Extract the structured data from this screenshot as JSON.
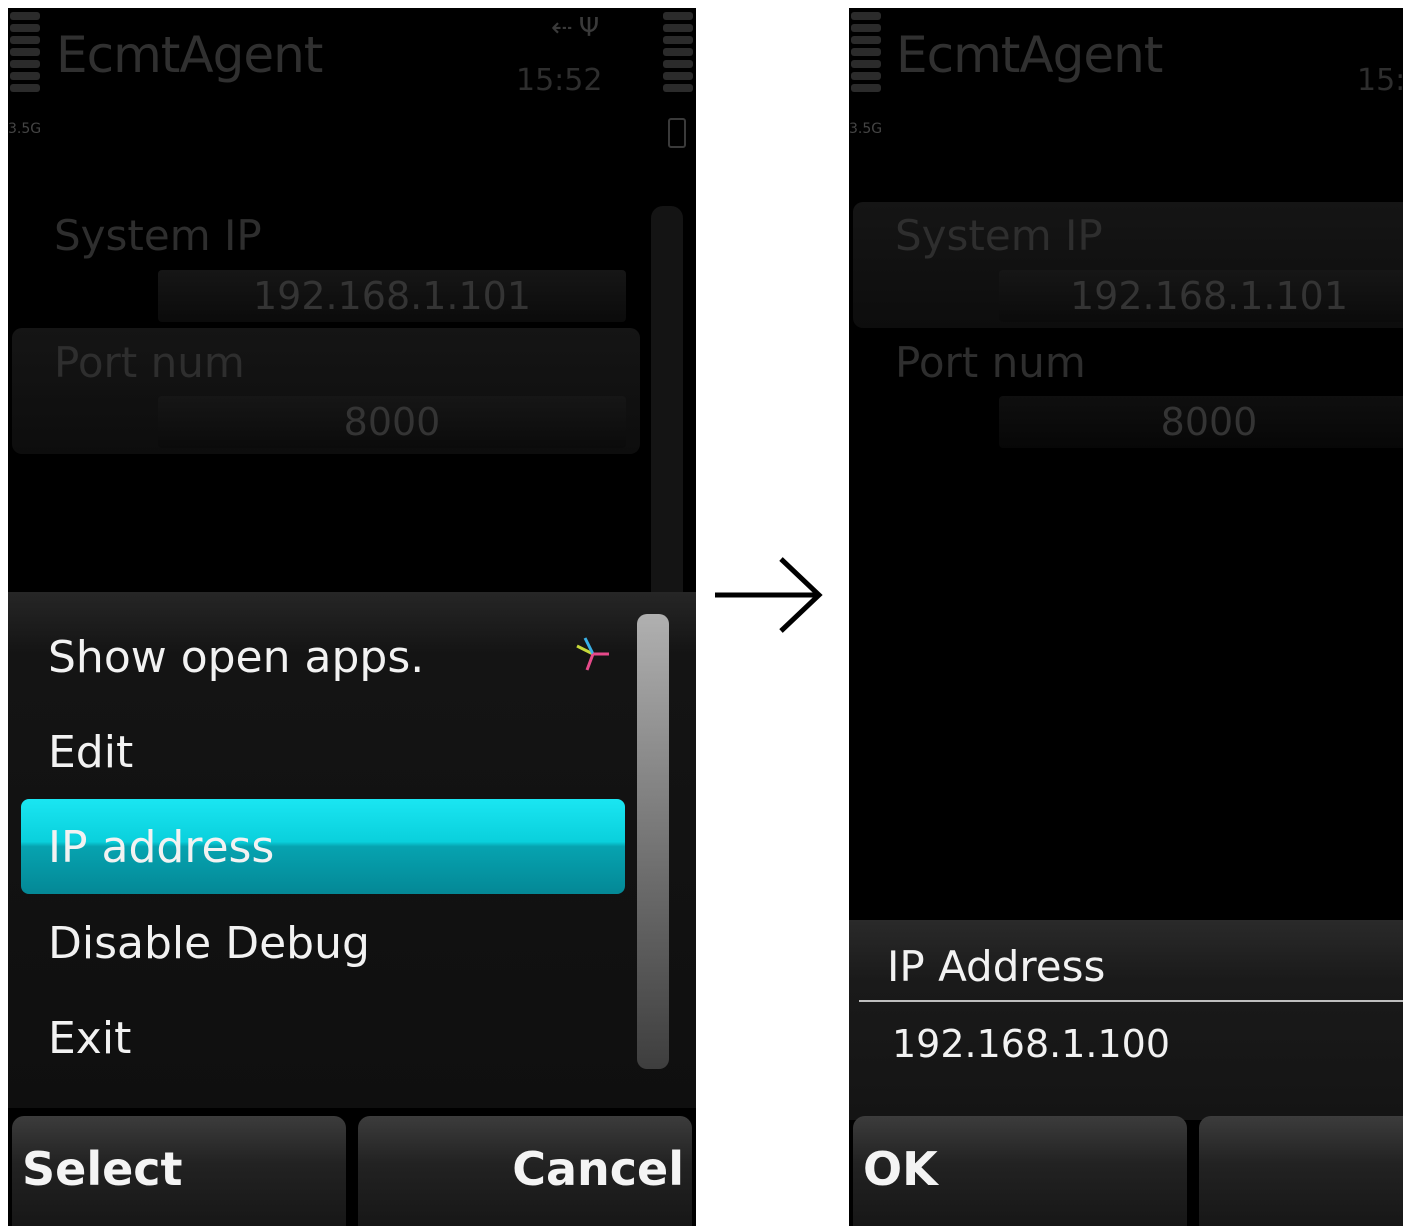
{
  "left_screen": {
    "app_title": "EcmtAgent",
    "clock": "15:52",
    "network": "3.5G",
    "fields": [
      {
        "label": "System IP",
        "value": "192.168.1.101"
      },
      {
        "label": "Port num",
        "value": "8000"
      }
    ],
    "menu": {
      "items": [
        "Show open apps.",
        "Edit",
        "IP address",
        "Disable Debug",
        "Exit"
      ],
      "selected": "IP address"
    },
    "softkeys": {
      "left": "Select",
      "right": "Cancel"
    }
  },
  "right_screen": {
    "app_title": "EcmtAgent",
    "clock": "15:",
    "network": "3.5G",
    "fields": [
      {
        "label": "System IP",
        "value": "192.168.1.101"
      },
      {
        "label": "Port num",
        "value": "8000"
      }
    ],
    "dialog": {
      "title": "IP Address",
      "value": "192.168.1.100"
    },
    "softkeys": {
      "left": "OK",
      "right": ""
    }
  },
  "icons": {
    "signal": "signal-strength-icon",
    "battery": "battery-icon",
    "usb": "usb-icon",
    "antenna": "antenna-icon",
    "open_apps": "task-switcher-icon",
    "transition": "right-arrow-icon"
  },
  "colors": {
    "highlight": "#0ad0dc",
    "background": "#000000",
    "text": "#f2f2f2"
  }
}
